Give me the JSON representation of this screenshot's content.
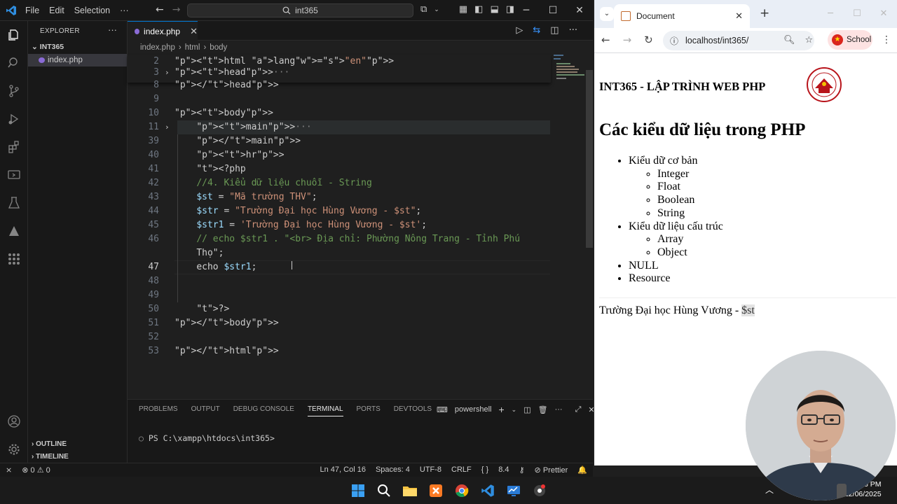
{
  "vscode": {
    "menu": [
      "File",
      "Edit",
      "Selection",
      "···"
    ],
    "search_text": "int365",
    "explorer": {
      "header": "EXPLORER",
      "folder": "INT365",
      "file": "index.php",
      "outline": "OUTLINE",
      "timeline": "TIMELINE"
    },
    "tab": {
      "label": "index.php"
    },
    "breadcrumb": [
      "index.php",
      "html",
      "body"
    ],
    "code_lines": [
      {
        "n": "2",
        "text": "<html lang=\"en\">"
      },
      {
        "n": "3",
        "text": "<head>···"
      },
      {
        "n": "8",
        "text": "</head>"
      },
      {
        "n": "9",
        "text": ""
      },
      {
        "n": "10",
        "text": "<body>"
      },
      {
        "n": "11",
        "text": "<main>···"
      },
      {
        "n": "39",
        "text": "</main>"
      },
      {
        "n": "40",
        "text": "<hr>"
      },
      {
        "n": "41",
        "text": "<?php"
      },
      {
        "n": "42",
        "text": "//4. Kiểu dữ liệu chuỗi - String"
      },
      {
        "n": "43",
        "text": "$st = \"Mã trường THV\";"
      },
      {
        "n": "44",
        "text": "$str = \"Trường Đại học Hùng Vương - $st\";"
      },
      {
        "n": "45",
        "text": "$str1 = 'Trường Đại học Hùng Vương - $st';"
      },
      {
        "n": "46",
        "text": "// echo $str1 . \"<br> Địa chỉ: Phường Nông Trang - Tỉnh Phú"
      },
      {
        "n": "",
        "text": "Thọ\";"
      },
      {
        "n": "47",
        "text": "echo $str1;"
      },
      {
        "n": "48",
        "text": ""
      },
      {
        "n": "49",
        "text": ""
      },
      {
        "n": "50",
        "text": "?>"
      },
      {
        "n": "51",
        "text": "</body>"
      },
      {
        "n": "52",
        "text": ""
      },
      {
        "n": "53",
        "text": "</html>"
      }
    ],
    "panel": {
      "tabs": [
        "PROBLEMS",
        "OUTPUT",
        "DEBUG CONSOLE",
        "TERMINAL",
        "PORTS",
        "DEVTOOLS"
      ],
      "active_tab": "TERMINAL",
      "shell": "powershell",
      "prompt": "PS C:\\xampp\\htdocs\\int365>"
    },
    "status": {
      "errors": "0",
      "warnings": "0",
      "position": "Ln 47, Col 16",
      "spaces": "Spaces: 4",
      "encoding": "UTF-8",
      "eol": "CRLF",
      "lang_braces": "{ }",
      "version": "8.4",
      "formatter": "Prettier"
    }
  },
  "browser": {
    "tab_title": "Document",
    "url": "localhost/int365/",
    "profile": "School",
    "page": {
      "site_title": "INT365 - LẬP TRÌNH WEB PHP",
      "heading": "Các kiểu dữ liệu trong PHP",
      "groups": [
        {
          "label": "Kiểu dữ cơ bản",
          "items": [
            "Integer",
            "Float",
            "Boolean",
            "String"
          ]
        },
        {
          "label": "Kiểu dữ liệu cấu trúc",
          "items": [
            "Array",
            "Object"
          ]
        }
      ],
      "extra_items": [
        "NULL",
        "Resource"
      ],
      "output_prefix": "Trường Đại học Hùng Vương - ",
      "output_var": "$st"
    }
  },
  "taskbar": {
    "time": "26 PM",
    "date": "12/06/2025"
  }
}
